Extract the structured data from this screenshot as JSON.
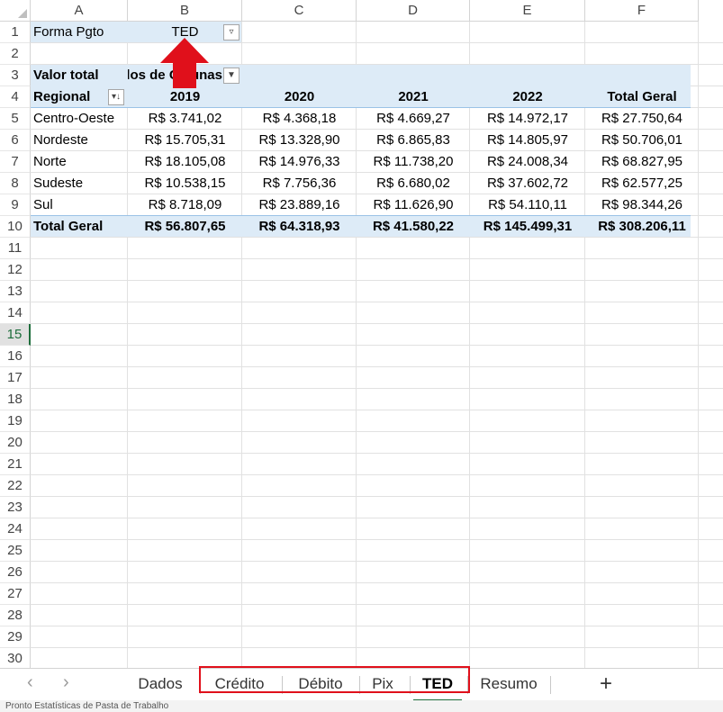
{
  "columns": [
    "A",
    "B",
    "C",
    "D",
    "E",
    "F"
  ],
  "rows": [
    "1",
    "2",
    "3",
    "4",
    "5",
    "6",
    "7",
    "8",
    "9",
    "10",
    "11",
    "12",
    "13",
    "14",
    "15",
    "16",
    "17",
    "18",
    "19",
    "20",
    "21",
    "22",
    "23",
    "24",
    "25",
    "26",
    "27",
    "28",
    "29",
    "30"
  ],
  "active_row": "15",
  "filter": {
    "label": "Forma Pgto",
    "value": "TED",
    "dropdown": "▼"
  },
  "pivot": {
    "value_label": "Valor total",
    "col_label": "Rótulos de Colunas",
    "row_label": "Regional",
    "years": [
      "2019",
      "2020",
      "2021",
      "2022",
      "Total Geral"
    ],
    "rows": [
      {
        "name": "Centro-Oeste",
        "values": [
          "R$ 3.741,02",
          "R$ 4.368,18",
          "R$ 4.669,27",
          "R$ 14.972,17",
          "R$ 27.750,64"
        ]
      },
      {
        "name": "Nordeste",
        "values": [
          "R$ 15.705,31",
          "R$ 13.328,90",
          "R$ 6.865,83",
          "R$ 14.805,97",
          "R$ 50.706,01"
        ]
      },
      {
        "name": "Norte",
        "values": [
          "R$ 18.105,08",
          "R$ 14.976,33",
          "R$ 11.738,20",
          "R$ 24.008,34",
          "R$ 68.827,95"
        ]
      },
      {
        "name": "Sudeste",
        "values": [
          "R$ 10.538,15",
          "R$ 7.756,36",
          "R$ 6.680,02",
          "R$ 37.602,72",
          "R$ 62.577,25"
        ]
      },
      {
        "name": "Sul",
        "values": [
          "R$ 8.718,09",
          "R$ 23.889,16",
          "R$ 11.626,90",
          "R$ 54.110,11",
          "R$ 98.344,26"
        ]
      }
    ],
    "total": {
      "name": "Total Geral",
      "values": [
        "R$ 56.807,65",
        "R$ 64.318,93",
        "R$ 41.580,22",
        "R$ 145.499,31",
        "R$ 308.206,11"
      ]
    }
  },
  "tabs": {
    "prev": "‹",
    "next": "›",
    "sheets": [
      "Dados",
      "Crédito",
      "Débito",
      "Pix",
      "TED",
      "Resumo"
    ],
    "active": "TED",
    "add": "+"
  },
  "status_text": "Pronto   Estatísticas de Pasta de Trabalho",
  "colors": {
    "pivot_band": "#ddebf7",
    "annotation_red": "#e0101b",
    "active_green": "#1e6e3c"
  }
}
